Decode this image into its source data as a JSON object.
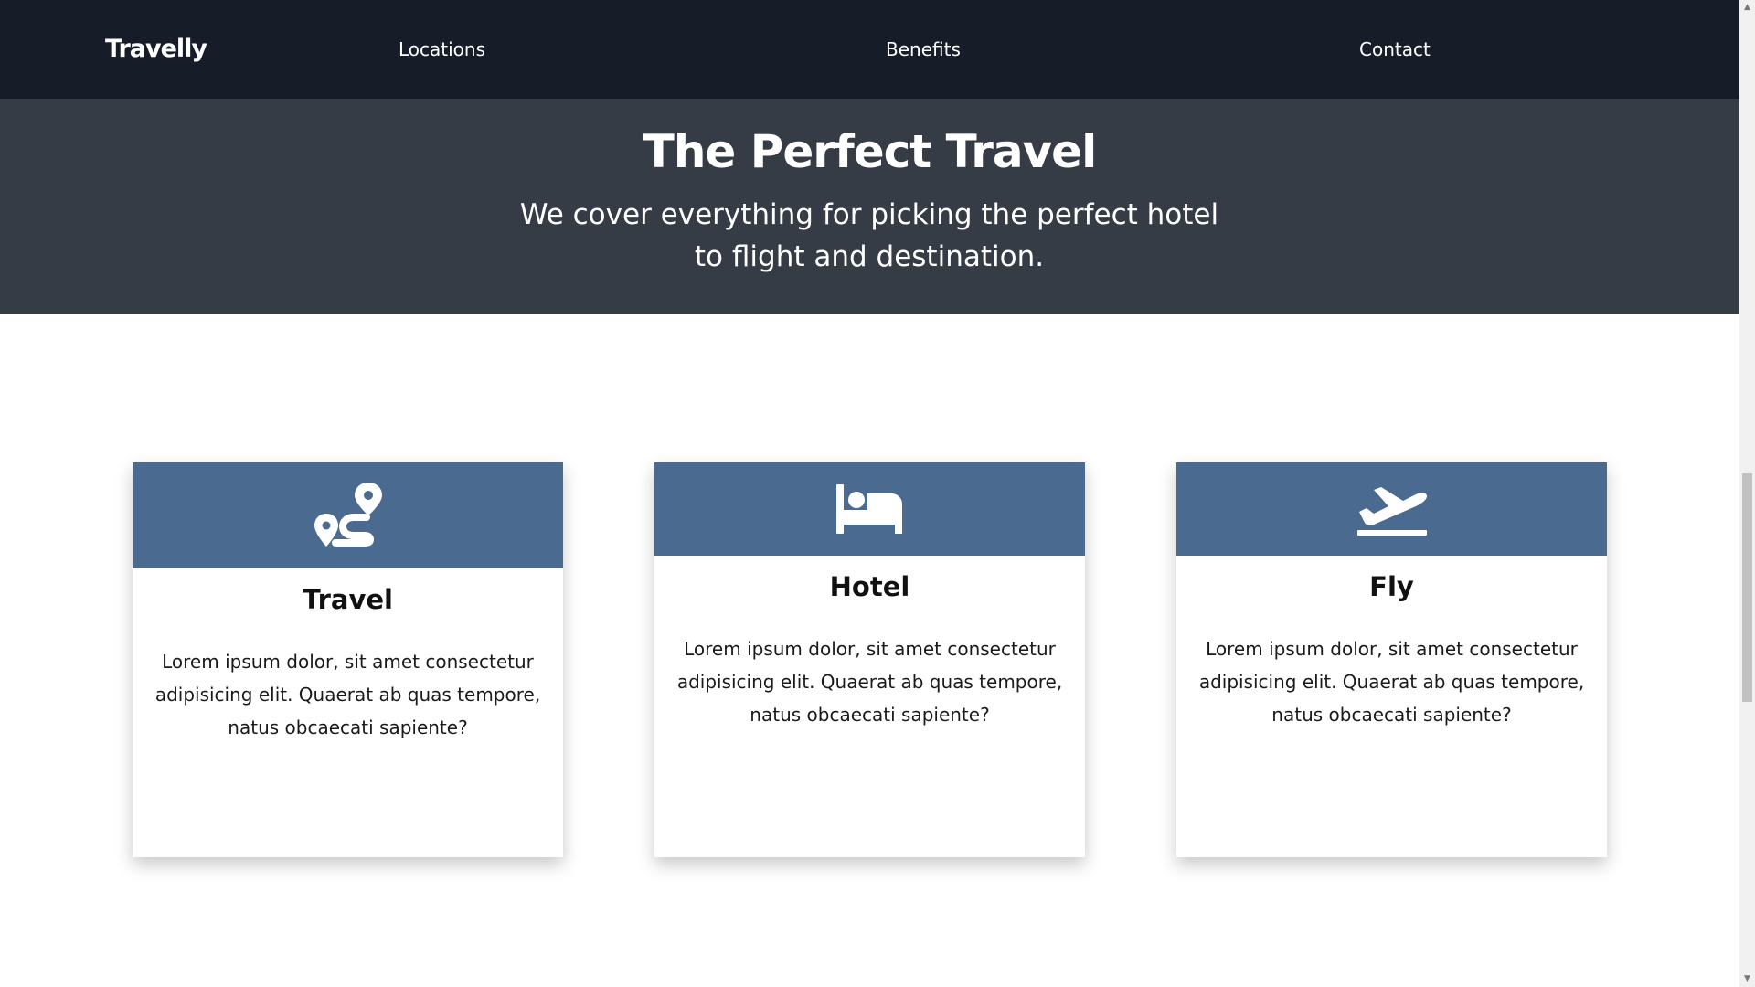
{
  "nav": {
    "brand": "Travelly",
    "links": [
      {
        "label": "Locations"
      },
      {
        "label": "Benefits"
      },
      {
        "label": "Contact"
      }
    ]
  },
  "hero": {
    "title": "The Perfect Travel",
    "subtitle": "We cover everything for picking the perfect hotel to flight and destination."
  },
  "cards": [
    {
      "icon": "route-icon",
      "title": "Travel",
      "text": "Lorem ipsum dolor, sit amet consectetur adipisicing elit. Quaerat ab quas tempore, natus obcaecati sapiente?"
    },
    {
      "icon": "bed-icon",
      "title": "Hotel",
      "text": "Lorem ipsum dolor, sit amet consectetur adipisicing elit. Quaerat ab quas tempore, natus obcaecati sapiente?"
    },
    {
      "icon": "plane-departure-icon",
      "title": "Fly",
      "text": "Lorem ipsum dolor, sit amet consectetur adipisicing elit. Quaerat ab quas tempore, natus obcaecati sapiente?"
    }
  ],
  "colors": {
    "navbar_bg": "#161d28",
    "hero_bg": "#353c45",
    "card_header_bg": "#4a6a8f",
    "text_light": "#ffffff",
    "text_dark": "#111111"
  }
}
